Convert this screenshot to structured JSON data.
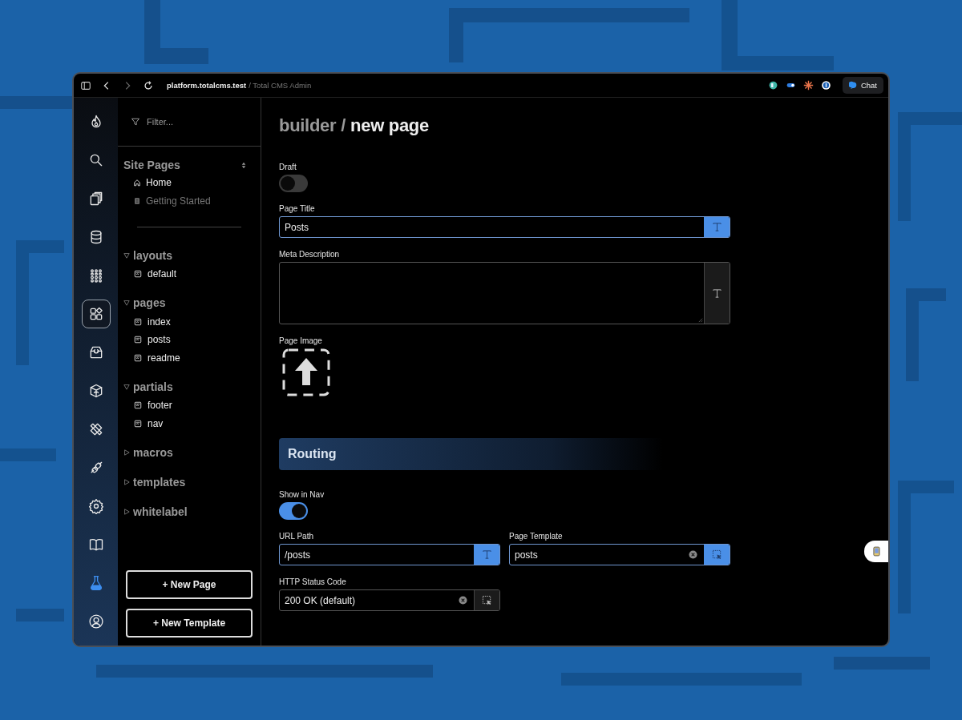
{
  "browser": {
    "host": "platform.totalcms.test",
    "title": "/ Total CMS Admin",
    "chat_button": "Chat"
  },
  "nav_rail": [
    {
      "selected": false,
      "accent": false
    },
    {
      "selected": false,
      "accent": false
    },
    {
      "selected": false,
      "accent": false
    },
    {
      "selected": false,
      "accent": false
    },
    {
      "selected": false,
      "accent": false
    },
    {
      "selected": true,
      "accent": false
    },
    {
      "selected": false,
      "accent": false
    },
    {
      "selected": false,
      "accent": false
    },
    {
      "selected": false,
      "accent": false
    },
    {
      "selected": false,
      "accent": false
    },
    {
      "selected": false,
      "accent": false
    },
    {
      "selected": false,
      "accent": false
    },
    {
      "selected": false,
      "accent": true
    },
    {
      "selected": false,
      "accent": false
    }
  ],
  "sidebar": {
    "filter": {
      "placeholder": "Filter..."
    },
    "site_pages": {
      "title": "Site Pages",
      "items": [
        {
          "label": "Home",
          "kind": "home",
          "disabled": false
        },
        {
          "label": "Getting Started",
          "kind": "page",
          "disabled": true
        }
      ]
    },
    "groups": [
      {
        "label": "layouts",
        "expanded": true,
        "children": [
          {
            "label": "default"
          }
        ]
      },
      {
        "label": "pages",
        "expanded": true,
        "children": [
          {
            "label": "index"
          },
          {
            "label": "posts"
          },
          {
            "label": "readme"
          }
        ]
      },
      {
        "label": "partials",
        "expanded": true,
        "children": [
          {
            "label": "footer"
          },
          {
            "label": "nav"
          }
        ]
      },
      {
        "label": "macros",
        "expanded": false
      },
      {
        "label": "templates",
        "expanded": false
      },
      {
        "label": "whitelabel",
        "expanded": false
      }
    ],
    "buttons": [
      "+ New Page",
      "+ New Template"
    ]
  },
  "main": {
    "breadcrumb": {
      "parent": "builder",
      "separator": "/",
      "current": "new page"
    },
    "sections": [
      {
        "fields": [
          {
            "kind": "toggle",
            "label": "Draft",
            "on": false
          },
          {
            "kind": "text",
            "label": "Page Title",
            "value": "Posts",
            "focused": true
          },
          {
            "kind": "textarea",
            "label": "Meta Description",
            "focused": false
          },
          {
            "label": "Page Image"
          }
        ]
      },
      {
        "title": "Routing",
        "fields": [
          {
            "kind": "toggle",
            "label": "Show in Nav",
            "on": true
          },
          {
            "kind": "text",
            "label": "URL Path",
            "value": "/posts",
            "focused": true
          },
          {
            "kind": "select",
            "label": "Page Template",
            "value": "posts",
            "focused": true
          },
          {
            "kind": "select",
            "label": "HTTP Status Code",
            "value": "200 OK (default)",
            "focused": false
          }
        ]
      }
    ]
  }
}
